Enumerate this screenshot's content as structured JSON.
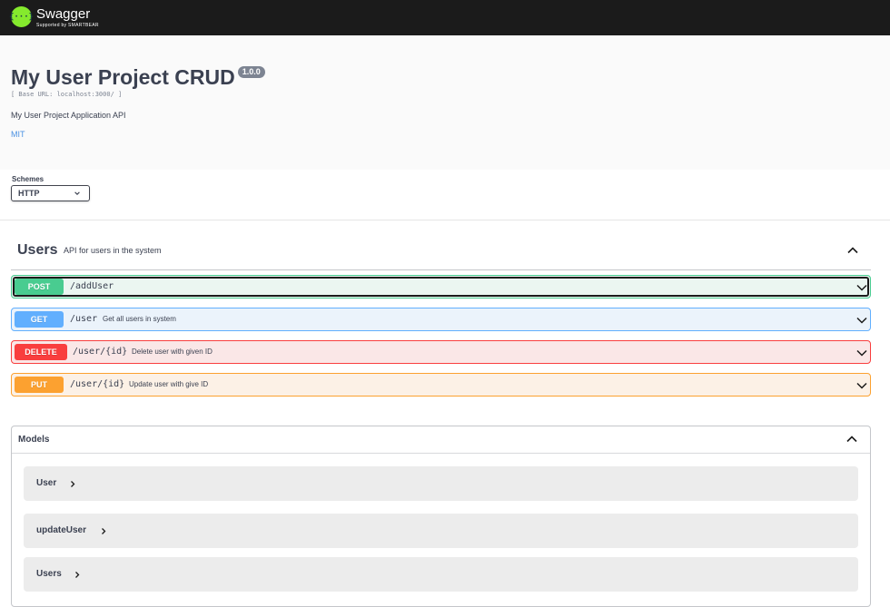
{
  "topbar": {
    "logo_glyph": "{···}",
    "logo_name": "Swagger",
    "logo_sub": "Supported by SMARTBEAR"
  },
  "info": {
    "title": "My User Project CRUD",
    "version": "1.0.0",
    "base_url": "[ Base URL: localhost:3000/ ]",
    "description": "My User Project Application API",
    "license": "MIT"
  },
  "schemes": {
    "label": "Schemes",
    "selected": "HTTP"
  },
  "tag": {
    "name": "Users",
    "description": "API for users in the system"
  },
  "operations": [
    {
      "method": "POST",
      "path": "/addUser",
      "summary": ""
    },
    {
      "method": "GET",
      "path": "/user",
      "summary": "Get all users in system"
    },
    {
      "method": "DELETE",
      "path": "/user/{id}",
      "summary": "Delete user with given ID"
    },
    {
      "method": "PUT",
      "path": "/user/{id}",
      "summary": "Update user with give ID"
    }
  ],
  "models": {
    "title": "Models",
    "items": [
      {
        "name": "User"
      },
      {
        "name": "updateUser"
      },
      {
        "name": "Users"
      }
    ]
  },
  "colors": {
    "post": "#49cc90",
    "get": "#61affe",
    "delete": "#f93e3e",
    "put": "#fca130",
    "topbar": "#1b1b1b",
    "swagger_green": "#85ea2d",
    "link": "#4990e2"
  }
}
